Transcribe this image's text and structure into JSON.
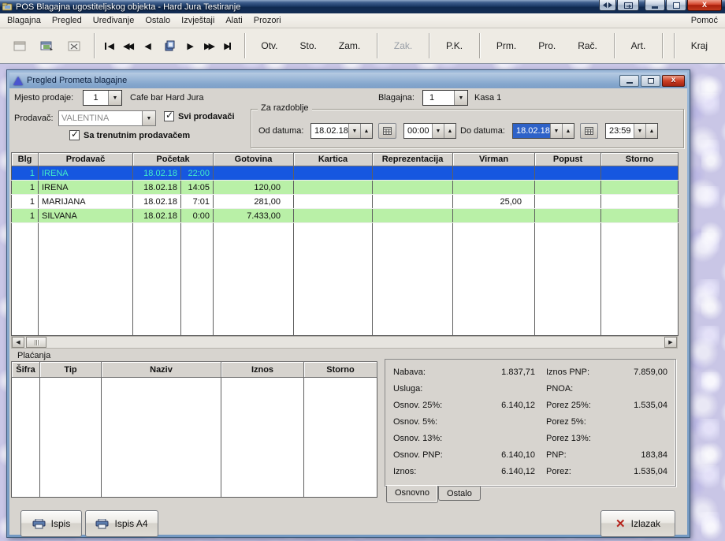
{
  "titlebar": {
    "title": "POS Blagajna ugostiteljskog objekta - Hard Jura Testiranje"
  },
  "menubar": {
    "items": [
      "Blagajna",
      "Pregled",
      "Uređivanje",
      "Ostalo",
      "Izvještaji",
      "Alati",
      "Prozori"
    ],
    "help": "Pomoć"
  },
  "toolbar": {
    "buttons": {
      "otv": "Otv.",
      "sto": "Sto.",
      "zam": "Zam.",
      "zak": "Zak.",
      "pk": "P.K.",
      "prm": "Prm.",
      "pro": "Pro.",
      "rac": "Rač.",
      "art": "Art.",
      "kraj": "Kraj"
    }
  },
  "dialog": {
    "title": "Pregled Prometa blagajne",
    "filters": {
      "mjesto_label": "Mjesto prodaje:",
      "mjesto_value": "1",
      "mjesto_name": "Cafe bar Hard Jura",
      "blagajna_label": "Blagajna:",
      "blagajna_value": "1",
      "blagajna_name": "Kasa 1",
      "prodavac_label": "Prodavač:",
      "prodavac_value": "VALENTINA",
      "svi_prodavaci": "Svi prodavači",
      "sa_trenutnim": "Sa trenutnim prodavačem",
      "razdoblje": "Za razdoblje",
      "od_label": "Od datuma:",
      "od_date": "18.02.18",
      "od_time": "00:00",
      "do_label": "Do datuma:",
      "do_date": "18.02.18",
      "do_time": "23:59"
    },
    "grid": {
      "col_blg": "Blg",
      "col_prodavac": "Prodavač",
      "col_pocetak": "Početak",
      "col_gotovina": "Gotovina",
      "col_kartica": "Kartica",
      "col_reprezentacija": "Reprezentacija",
      "col_virman": "Virman",
      "col_popust": "Popust",
      "col_storno": "Storno",
      "rows": [
        {
          "blg": "1",
          "prodavac": "IRENA",
          "datum": "18.02.18",
          "vrijeme": "22:00",
          "gotovina": "",
          "kartica": "",
          "reprezentacija": "",
          "virman": "",
          "popust": "",
          "storno": ""
        },
        {
          "blg": "1",
          "prodavac": "IRENA",
          "datum": "18.02.18",
          "vrijeme": "14:05",
          "gotovina": "120,00",
          "kartica": "",
          "reprezentacija": "",
          "virman": "",
          "popust": "",
          "storno": ""
        },
        {
          "blg": "1",
          "prodavac": "MARIJANA",
          "datum": "18.02.18",
          "vrijeme": "7:01",
          "gotovina": "281,00",
          "kartica": "",
          "reprezentacija": "",
          "virman": "25,00",
          "popust": "",
          "storno": ""
        },
        {
          "blg": "1",
          "prodavac": "SILVANA",
          "datum": "18.02.18",
          "vrijeme": "0:00",
          "gotovina": "7.433,00",
          "kartica": "",
          "reprezentacija": "",
          "virman": "",
          "popust": "",
          "storno": ""
        }
      ]
    },
    "placanja": {
      "title": "Plaćanja",
      "col_sifra": "Šifra",
      "col_tip": "Tip",
      "col_naziv": "Naziv",
      "col_iznos": "Iznos",
      "col_storno": "Storno"
    },
    "summary": {
      "rows": [
        {
          "l_label": "Nabava:",
          "l_value": "1.837,71",
          "r_label": "Iznos PNP:",
          "r_value": "7.859,00"
        },
        {
          "l_label": "Usluga:",
          "l_value": "",
          "r_label": "PNOA:",
          "r_value": ""
        },
        {
          "l_label": "Osnov. 25%:",
          "l_value": "6.140,12",
          "r_label": "Porez 25%:",
          "r_value": "1.535,04"
        },
        {
          "l_label": "Osnov. 5%:",
          "l_value": "",
          "r_label": "Porez 5%:",
          "r_value": ""
        },
        {
          "l_label": "Osnov. 13%:",
          "l_value": "",
          "r_label": "Porez 13%:",
          "r_value": ""
        },
        {
          "l_label": "Osnov. PNP:",
          "l_value": "6.140,10",
          "r_label": "PNP:",
          "r_value": "183,84"
        },
        {
          "l_label": "Iznos:",
          "l_value": "6.140,12",
          "r_label": "Porez:",
          "r_value": "1.535,04"
        }
      ],
      "tab_osnovno": "Osnovno",
      "tab_ostalo": "Ostalo"
    },
    "buttons": {
      "ispis": "Ispis",
      "ispis_a4": "Ispis A4",
      "izlazak": "Izlazak"
    }
  }
}
